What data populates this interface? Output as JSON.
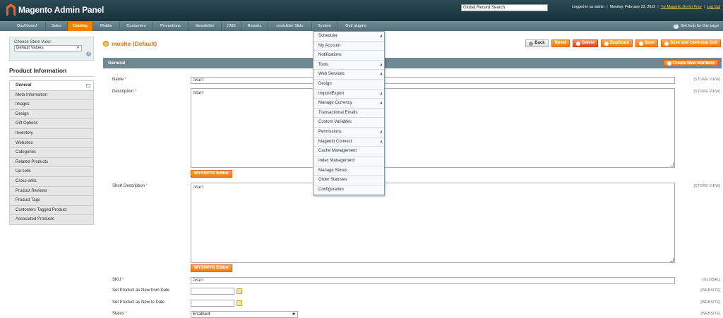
{
  "header": {
    "logo_text": "Magento Admin Panel",
    "search_value": "Global Record Search",
    "logged_in": "Logged in as admin",
    "date": "Monday, February 23, 2015",
    "try_link": "Try Magento Go for Free",
    "logout": "Log Out"
  },
  "nav": {
    "items": [
      "Dashboard",
      "Sales",
      "Catalog",
      "Mobile",
      "Customers",
      "Promotions",
      "Newsletter",
      "CMS",
      "Reports",
      "coolslider Slide",
      "System",
      "Giril plugins"
    ],
    "active": "Catalog",
    "help": "Get help for this page"
  },
  "sidebar": {
    "store_label": "Choose Store View:",
    "store_value": "Default Values",
    "title": "Product Information",
    "tabs": [
      "General",
      "Meta Information",
      "Images",
      "Design",
      "Gift Options",
      "Inventory",
      "Websites",
      "Categories",
      "Related Products",
      "Up-sells",
      "Cross-sells",
      "Product Reviews",
      "Product Tags",
      "Customers Tagged Product",
      "Associated Products"
    ]
  },
  "main": {
    "title": "moshe (Default)",
    "buttons": {
      "back": "Back",
      "reset": "Reset",
      "delete": "Delete",
      "duplicate": "Duplicate",
      "save": "Save",
      "save_continue": "Save and Continue Edit"
    },
    "section_title": "General",
    "create_attr": "Create New Attribute",
    "wysiwyg": "WYSIWYG Editor",
    "fields": {
      "name": {
        "label": "Name",
        "value": "דוגמה",
        "scope": "[STORE VIEW]"
      },
      "description": {
        "label": "Description",
        "value": "דוגמה",
        "scope": "[STORE VIEW]"
      },
      "short_description": {
        "label": "Short Description",
        "value": "דוגמה",
        "scope": "[STORE VIEW]"
      },
      "sku": {
        "label": "SKU",
        "value": "דוגמה",
        "scope": "[GLOBAL]"
      },
      "new_from": {
        "label": "Set Product as New from Date",
        "value": "",
        "scope": "[WEBSITE]"
      },
      "new_to": {
        "label": "Set Product as New to Date",
        "value": "",
        "scope": "[WEBSITE]"
      },
      "status": {
        "label": "Status",
        "value": "Enabled",
        "scope": "[WEBSITE]"
      }
    }
  },
  "system_menu": {
    "items": [
      {
        "label": "Scheduler",
        "submenu": true
      },
      {
        "label": "My Account",
        "submenu": false
      },
      {
        "label": "Notifications",
        "submenu": false
      },
      {
        "label": "Tools",
        "submenu": true
      },
      {
        "label": "Web Services",
        "submenu": true
      },
      {
        "label": "Design",
        "submenu": false
      },
      {
        "label": "Import/Export",
        "submenu": true
      },
      {
        "label": "Manage Currency",
        "submenu": true
      },
      {
        "label": "Transactional Emails",
        "submenu": false
      },
      {
        "label": "Custom Variables",
        "submenu": false
      },
      {
        "label": "Permissions",
        "submenu": true
      },
      {
        "label": "Magento Connect",
        "submenu": true
      },
      {
        "label": "Cache Management",
        "submenu": false
      },
      {
        "label": "Index Management",
        "submenu": false
      },
      {
        "label": "Manage Stores",
        "submenu": false
      },
      {
        "label": "Order Statuses",
        "submenu": false
      },
      {
        "label": "Configuration",
        "submenu": false
      }
    ]
  }
}
